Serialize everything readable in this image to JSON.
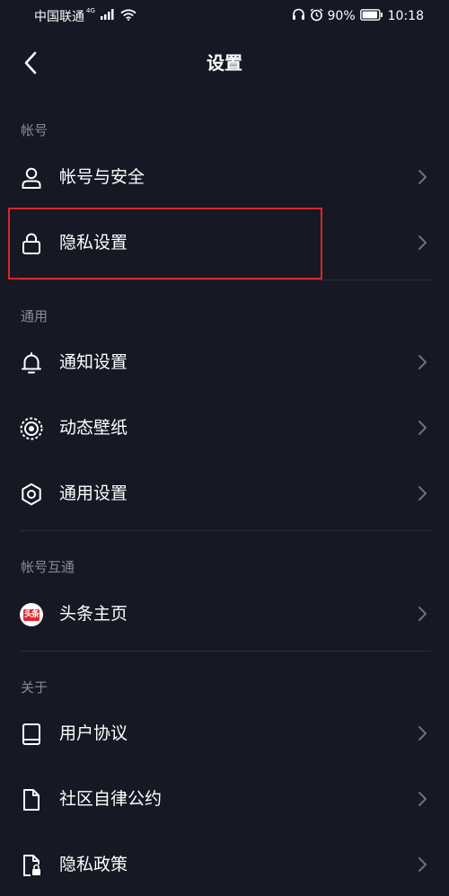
{
  "status_bar": {
    "carrier": "中国联通",
    "network": "4G",
    "battery": "90%",
    "time": "10:18"
  },
  "nav": {
    "title": "设置"
  },
  "sections": [
    {
      "header": "帐号",
      "items": [
        {
          "label": "帐号与安全",
          "icon": "user-icon"
        },
        {
          "label": "隐私设置",
          "icon": "lock-icon"
        }
      ]
    },
    {
      "header": "通用",
      "items": [
        {
          "label": "通知设置",
          "icon": "bell-icon"
        },
        {
          "label": "动态壁纸",
          "icon": "live-wallpaper-icon"
        },
        {
          "label": "通用设置",
          "icon": "gear-icon"
        }
      ]
    },
    {
      "header": "帐号互通",
      "items": [
        {
          "label": "头条主页",
          "icon": "toutiao-logo-icon",
          "badge_text": "头条",
          "badge_color": "#e1262c"
        }
      ]
    },
    {
      "header": "关于",
      "items": [
        {
          "label": "用户协议",
          "icon": "book-icon"
        },
        {
          "label": "社区自律公约",
          "icon": "document-icon"
        },
        {
          "label": "隐私政策",
          "icon": "privacy-document-icon"
        }
      ]
    }
  ],
  "colors": {
    "background": "#161823",
    "section_header": "#8a8b91",
    "divider": "#2a2c37",
    "highlight": "#d8262f"
  }
}
